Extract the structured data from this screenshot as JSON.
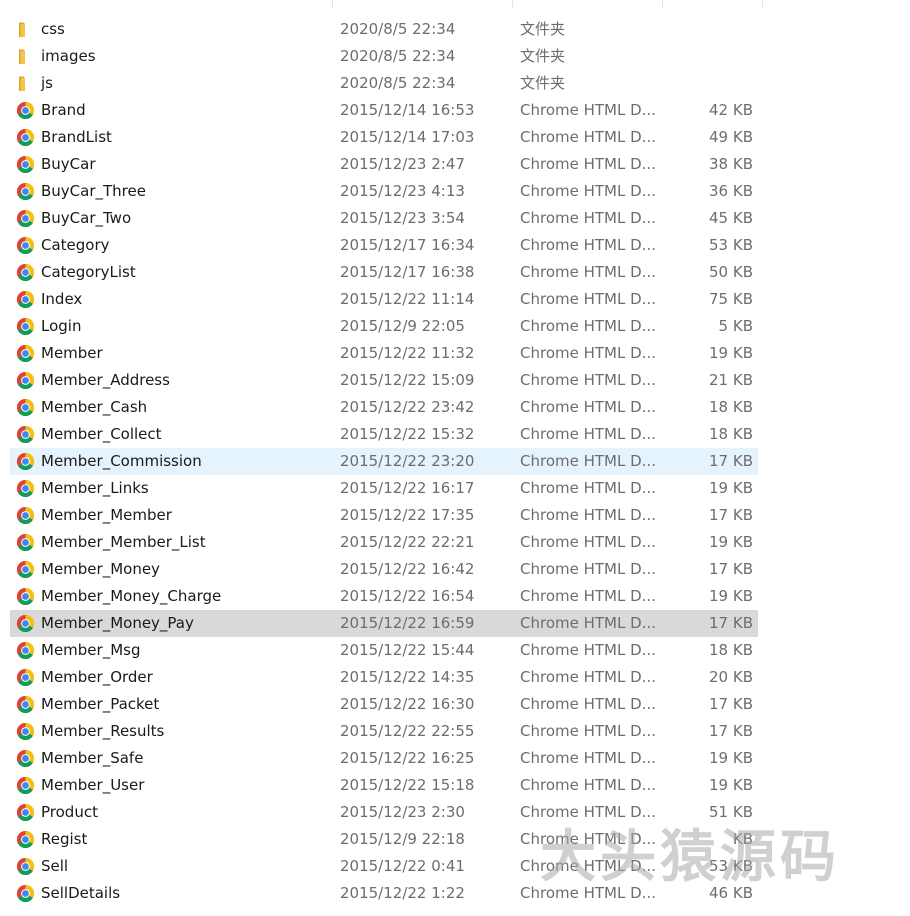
{
  "files": [
    {
      "name": "css",
      "date": "2020/8/5 22:34",
      "type": "文件夹",
      "size": "",
      "icon": "folder-icon"
    },
    {
      "name": "images",
      "date": "2020/8/5 22:34",
      "type": "文件夹",
      "size": "",
      "icon": "folder-icon"
    },
    {
      "name": "js",
      "date": "2020/8/5 22:34",
      "type": "文件夹",
      "size": "",
      "icon": "folder-icon"
    },
    {
      "name": "Brand",
      "date": "2015/12/14 16:53",
      "type": "Chrome HTML D...",
      "size": "42 KB",
      "icon": "chrome-icon"
    },
    {
      "name": "BrandList",
      "date": "2015/12/14 17:03",
      "type": "Chrome HTML D...",
      "size": "49 KB",
      "icon": "chrome-icon"
    },
    {
      "name": "BuyCar",
      "date": "2015/12/23 2:47",
      "type": "Chrome HTML D...",
      "size": "38 KB",
      "icon": "chrome-icon"
    },
    {
      "name": "BuyCar_Three",
      "date": "2015/12/23 4:13",
      "type": "Chrome HTML D...",
      "size": "36 KB",
      "icon": "chrome-icon"
    },
    {
      "name": "BuyCar_Two",
      "date": "2015/12/23 3:54",
      "type": "Chrome HTML D...",
      "size": "45 KB",
      "icon": "chrome-icon"
    },
    {
      "name": "Category",
      "date": "2015/12/17 16:34",
      "type": "Chrome HTML D...",
      "size": "53 KB",
      "icon": "chrome-icon"
    },
    {
      "name": "CategoryList",
      "date": "2015/12/17 16:38",
      "type": "Chrome HTML D...",
      "size": "50 KB",
      "icon": "chrome-icon"
    },
    {
      "name": "Index",
      "date": "2015/12/22 11:14",
      "type": "Chrome HTML D...",
      "size": "75 KB",
      "icon": "chrome-icon"
    },
    {
      "name": "Login",
      "date": "2015/12/9 22:05",
      "type": "Chrome HTML D...",
      "size": "5 KB",
      "icon": "chrome-icon"
    },
    {
      "name": "Member",
      "date": "2015/12/22 11:32",
      "type": "Chrome HTML D...",
      "size": "19 KB",
      "icon": "chrome-icon"
    },
    {
      "name": "Member_Address",
      "date": "2015/12/22 15:09",
      "type": "Chrome HTML D...",
      "size": "21 KB",
      "icon": "chrome-icon"
    },
    {
      "name": "Member_Cash",
      "date": "2015/12/22 23:42",
      "type": "Chrome HTML D...",
      "size": "18 KB",
      "icon": "chrome-icon"
    },
    {
      "name": "Member_Collect",
      "date": "2015/12/22 15:32",
      "type": "Chrome HTML D...",
      "size": "18 KB",
      "icon": "chrome-icon"
    },
    {
      "name": "Member_Commission",
      "date": "2015/12/22 23:20",
      "type": "Chrome HTML D...",
      "size": "17 KB",
      "icon": "chrome-icon",
      "state": "hover"
    },
    {
      "name": "Member_Links",
      "date": "2015/12/22 16:17",
      "type": "Chrome HTML D...",
      "size": "19 KB",
      "icon": "chrome-icon"
    },
    {
      "name": "Member_Member",
      "date": "2015/12/22 17:35",
      "type": "Chrome HTML D...",
      "size": "17 KB",
      "icon": "chrome-icon"
    },
    {
      "name": "Member_Member_List",
      "date": "2015/12/22 22:21",
      "type": "Chrome HTML D...",
      "size": "19 KB",
      "icon": "chrome-icon"
    },
    {
      "name": "Member_Money",
      "date": "2015/12/22 16:42",
      "type": "Chrome HTML D...",
      "size": "17 KB",
      "icon": "chrome-icon"
    },
    {
      "name": "Member_Money_Charge",
      "date": "2015/12/22 16:54",
      "type": "Chrome HTML D...",
      "size": "19 KB",
      "icon": "chrome-icon"
    },
    {
      "name": "Member_Money_Pay",
      "date": "2015/12/22 16:59",
      "type": "Chrome HTML D...",
      "size": "17 KB",
      "icon": "chrome-icon",
      "state": "selected"
    },
    {
      "name": "Member_Msg",
      "date": "2015/12/22 15:44",
      "type": "Chrome HTML D...",
      "size": "18 KB",
      "icon": "chrome-icon"
    },
    {
      "name": "Member_Order",
      "date": "2015/12/22 14:35",
      "type": "Chrome HTML D...",
      "size": "20 KB",
      "icon": "chrome-icon"
    },
    {
      "name": "Member_Packet",
      "date": "2015/12/22 16:30",
      "type": "Chrome HTML D...",
      "size": "17 KB",
      "icon": "chrome-icon"
    },
    {
      "name": "Member_Results",
      "date": "2015/12/22 22:55",
      "type": "Chrome HTML D...",
      "size": "17 KB",
      "icon": "chrome-icon"
    },
    {
      "name": "Member_Safe",
      "date": "2015/12/22 16:25",
      "type": "Chrome HTML D...",
      "size": "19 KB",
      "icon": "chrome-icon"
    },
    {
      "name": "Member_User",
      "date": "2015/12/22 15:18",
      "type": "Chrome HTML D...",
      "size": "19 KB",
      "icon": "chrome-icon"
    },
    {
      "name": "Product",
      "date": "2015/12/23 2:30",
      "type": "Chrome HTML D...",
      "size": "51 KB",
      "icon": "chrome-icon"
    },
    {
      "name": "Regist",
      "date": "2015/12/9 22:18",
      "type": "Chrome HTML D...",
      "size": "KB",
      "icon": "chrome-icon"
    },
    {
      "name": "Sell",
      "date": "2015/12/22 0:41",
      "type": "Chrome HTML D...",
      "size": "53 KB",
      "icon": "chrome-icon"
    },
    {
      "name": "SellDetails",
      "date": "2015/12/22 1:22",
      "type": "Chrome HTML D...",
      "size": "46 KB",
      "icon": "chrome-icon"
    }
  ],
  "watermark": "大头猿源码",
  "colors": {
    "hover_bg": "#e5f3ff",
    "selected_bg": "#d9d9d9",
    "folder": "#f4c54b",
    "chrome_red": "#db4437",
    "chrome_yellow": "#f4c20d",
    "chrome_green": "#0f9d58",
    "chrome_blue": "#4285f4"
  }
}
